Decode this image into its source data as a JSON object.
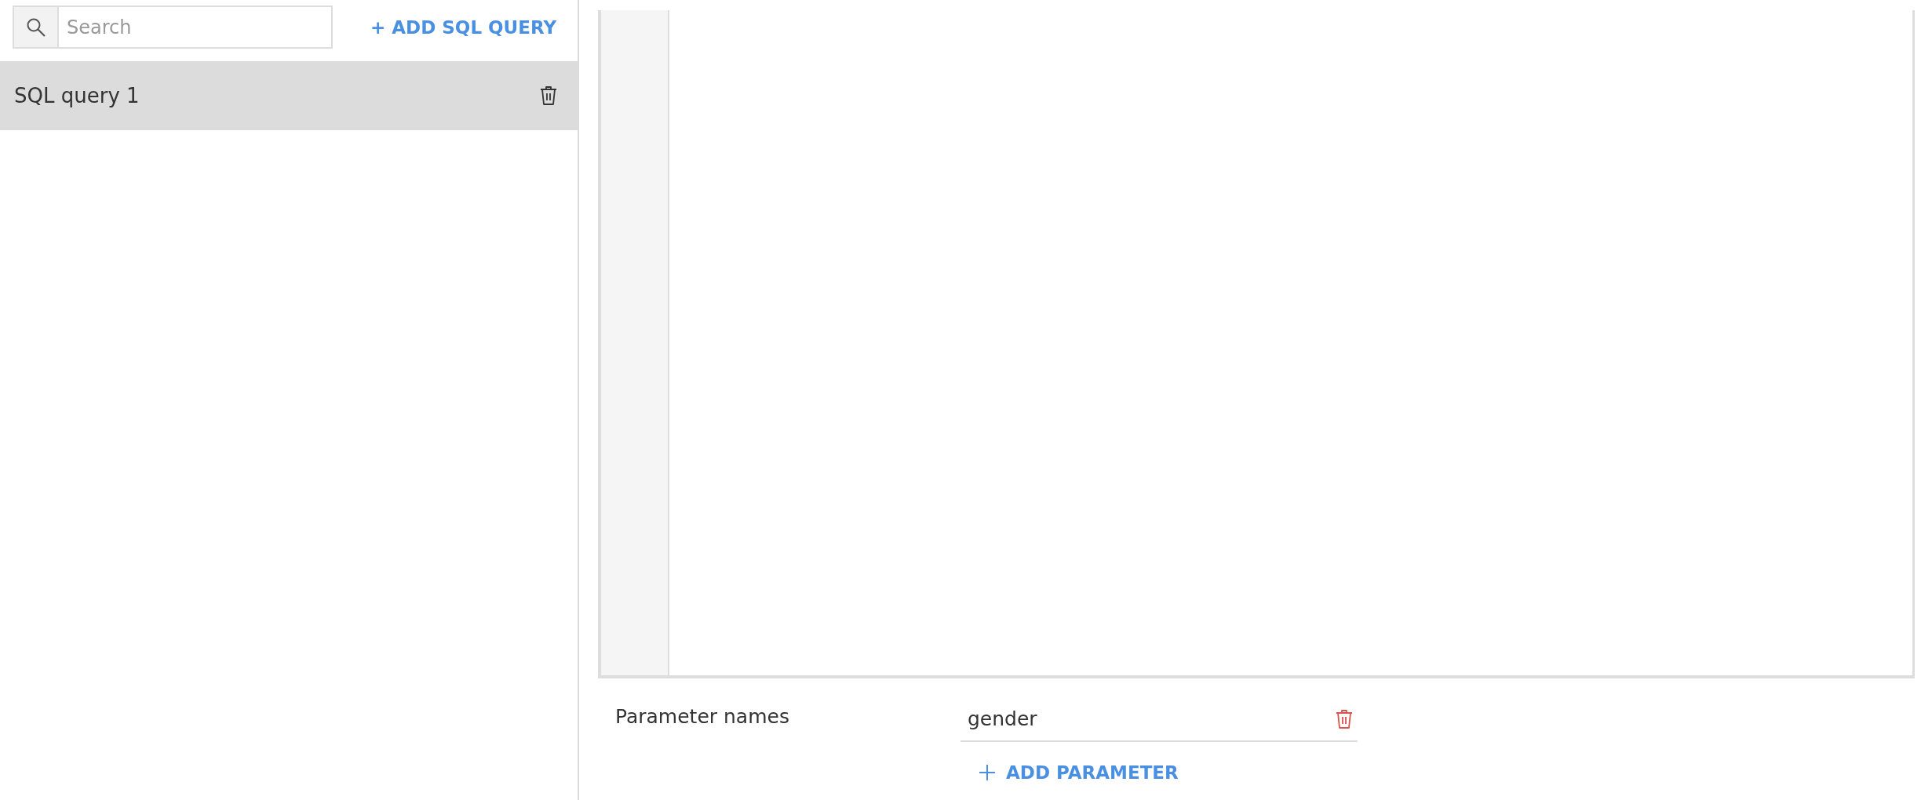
{
  "sidebar": {
    "search": {
      "placeholder": "Search"
    },
    "add_button": "+ ADD SQL QUERY",
    "items": [
      {
        "name": "SQL query 1",
        "selected": true
      }
    ]
  },
  "parameters": {
    "label": "Parameter names",
    "items": [
      {
        "value": "gender"
      }
    ],
    "add_button": "ADD PARAMETER"
  }
}
